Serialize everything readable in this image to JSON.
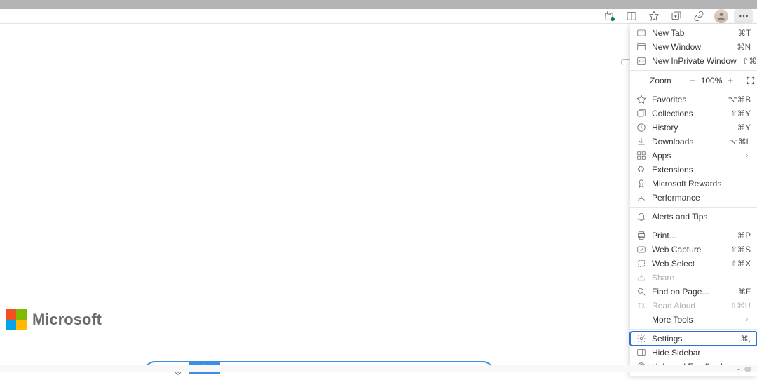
{
  "toolbar": {
    "icons": [
      "shopping",
      "split",
      "favorites",
      "collections",
      "share",
      "avatar",
      "more"
    ]
  },
  "menu": {
    "new_tab": {
      "label": "New Tab",
      "shortcut": "⌘T"
    },
    "new_window": {
      "label": "New Window",
      "shortcut": "⌘N"
    },
    "new_inprivate": {
      "label": "New InPrivate Window",
      "shortcut": "⇧⌘N"
    },
    "zoom": {
      "label": "Zoom",
      "value": "100%"
    },
    "favorites": {
      "label": "Favorites",
      "shortcut": "⌥⌘B"
    },
    "collections": {
      "label": "Collections",
      "shortcut": "⇧⌘Y"
    },
    "history": {
      "label": "History",
      "shortcut": "⌘Y"
    },
    "downloads": {
      "label": "Downloads",
      "shortcut": "⌥⌘L"
    },
    "apps": {
      "label": "Apps"
    },
    "extensions": {
      "label": "Extensions"
    },
    "rewards": {
      "label": "Microsoft Rewards"
    },
    "performance": {
      "label": "Performance"
    },
    "alerts": {
      "label": "Alerts and Tips"
    },
    "print": {
      "label": "Print...",
      "shortcut": "⌘P"
    },
    "web_capture": {
      "label": "Web Capture",
      "shortcut": "⇧⌘S"
    },
    "web_select": {
      "label": "Web Select",
      "shortcut": "⇧⌘X"
    },
    "share": {
      "label": "Share"
    },
    "find": {
      "label": "Find on Page...",
      "shortcut": "⌘F"
    },
    "read_aloud": {
      "label": "Read Aloud",
      "shortcut": "⇧⌘U"
    },
    "more_tools": {
      "label": "More Tools"
    },
    "settings": {
      "label": "Settings",
      "shortcut": "⌘,"
    },
    "hide_sidebar": {
      "label": "Hide Sidebar"
    },
    "help": {
      "label": "Help and Feedback"
    }
  },
  "content": {
    "brand": "Microsoft"
  }
}
